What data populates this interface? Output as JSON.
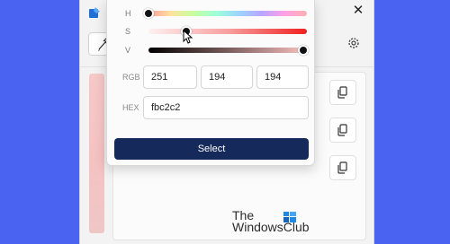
{
  "app": {
    "icon": "color-picker-app-icon",
    "close_glyph": "✕"
  },
  "editor": {
    "sliders": [
      {
        "label": "H",
        "value": 0
      },
      {
        "label": "S",
        "value": 0.24
      },
      {
        "label": "V",
        "value": 0.98
      }
    ],
    "rgb": {
      "label": "RGB",
      "r": "251",
      "g": "194",
      "b": "194"
    },
    "hex": {
      "label": "HEX",
      "value": "fbc2c2"
    },
    "select_label": "Select"
  },
  "history": {
    "copy_icon": "copy-icon"
  },
  "watermark": {
    "line1": "The",
    "line2": "WindowsClub"
  },
  "colors": {
    "desktop": "#4a63f0",
    "accent_button": "#15295a",
    "current_color": "#fbc2c2"
  }
}
